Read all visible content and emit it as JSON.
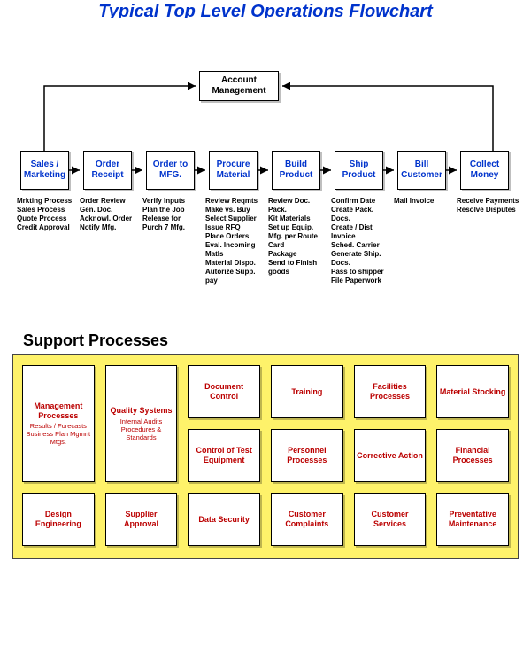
{
  "title": "Typical Top Level Operations Flowchart",
  "account": "Account Management",
  "steps": [
    {
      "label": "Sales / Marketing",
      "items": [
        "Mrkting Process",
        "Sales Process",
        "Quote Process",
        "Credit Approval"
      ]
    },
    {
      "label": "Order Receipt",
      "items": [
        "Order Review",
        "Gen. Doc.",
        "Acknowl. Order",
        "Notify Mfg."
      ]
    },
    {
      "label": "Order to MFG.",
      "items": [
        "Verify Inputs",
        "Plan the Job",
        "Release for Purch 7 Mfg."
      ]
    },
    {
      "label": "Procure Material",
      "items": [
        "Review Reqmts",
        "Make vs. Buy",
        "Select Supplier",
        "Issue RFQ",
        "Place Orders",
        "Eval. Incoming Matls",
        "Material Dispo.",
        "Autorize Supp. pay"
      ]
    },
    {
      "label": "Build Product",
      "items": [
        "Review Doc. Pack.",
        "Kit Materials",
        "Set up Equip.",
        "Mfg. per Route Card",
        "Package",
        "Send to Finish goods"
      ]
    },
    {
      "label": "Ship Product",
      "items": [
        "Confirm Date",
        "Create Pack. Docs.",
        "Create / Dist Invoice",
        "Sched. Carrier",
        "Generate Ship. Docs.",
        "Pass to shipper",
        "File Paperwork"
      ]
    },
    {
      "label": "Bill Customer",
      "items": [
        "Mail Invoice"
      ]
    },
    {
      "label": "Collect Money",
      "items": [
        "Receive Payments",
        "Resolve Disputes"
      ]
    }
  ],
  "supportTitle": "Support Processes",
  "support": {
    "r1c1": {
      "title": "Management Processes",
      "sub": "Results / Forecasts Business Plan Mgmnt Mtgs."
    },
    "r1c2": {
      "title": "Quality Systems",
      "sub": "Internal Audits Procedures & Standards"
    },
    "r1c3": "Document Control",
    "r1c4": "Training",
    "r1c5": "Facilities Processes",
    "r1c6": "Material Stocking",
    "r2c3": "Control of Test Equipment",
    "r2c4": "Personnel Processes",
    "r2c5": "Corrective Action",
    "r2c6": "Financial Processes",
    "r3c1": "Design Engineering",
    "r3c2": "Supplier Approval",
    "r3c3": "Data Security",
    "r3c4": "Customer Complaints",
    "r3c5": "Customer Services",
    "r3c6": "Preventative Maintenance"
  }
}
